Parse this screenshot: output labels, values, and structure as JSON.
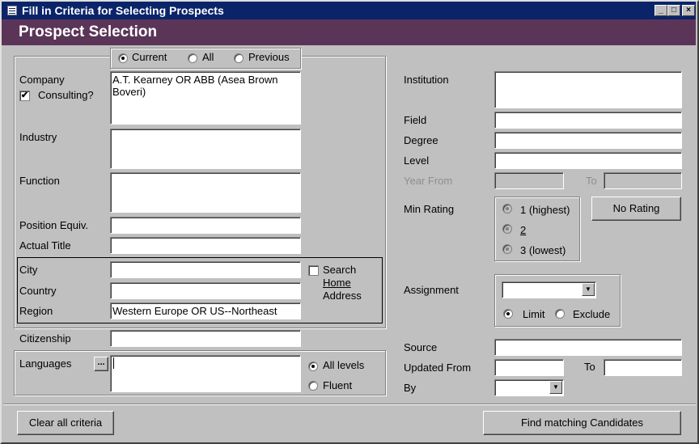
{
  "window": {
    "title": "Fill in Criteria for Selecting Prospects",
    "minimize": "_",
    "restore": "□",
    "close": "×"
  },
  "header": {
    "title": "Prospect Selection"
  },
  "scope": {
    "current": "Current",
    "all": "All",
    "previous": "Previous",
    "selected": "current"
  },
  "left": {
    "company_label": "Company",
    "consulting_label": "Consulting?",
    "consulting_checked": true,
    "consulting_mark": "✔",
    "company_value": "A.T. Kearney OR ABB (Asea Brown Boveri)",
    "industry_label": "Industry",
    "industry_value": "",
    "function_label": "Function",
    "function_value": "",
    "position_label": "Position Equiv.",
    "position_value": "",
    "actual_title_label": "Actual Title",
    "actual_title_value": "",
    "city_label": "City",
    "city_value": "",
    "country_label": "Country",
    "country_value": "",
    "region_label": "Region",
    "region_value": "Western Europe OR US--Northeast",
    "search_home_label1": "Search",
    "search_home_label2": "Home",
    "search_home_label3": "Address",
    "citizenship_label": "Citizenship",
    "citizenship_value": "",
    "languages_label": "Languages",
    "languages_button": "...",
    "languages_value": "",
    "all_levels": "All levels",
    "fluent": "Fluent"
  },
  "right": {
    "institution_label": "Institution",
    "field_label": "Field",
    "degree_label": "Degree",
    "level_label": "Level",
    "year_from_label": "Year From",
    "to_label": "To",
    "min_rating_label": "Min Rating",
    "rating_1": "1 (highest)",
    "rating_2": "2",
    "rating_3": "3 (lowest)",
    "no_rating": "No Rating",
    "assignment_label": "Assignment",
    "limit": "Limit",
    "exclude": "Exclude",
    "source_label": "Source",
    "updated_from_label": "Updated From",
    "updated_to_label": "To",
    "by_label": "By",
    "dropdown_arrow": "▼"
  },
  "footer": {
    "clear": "Clear all criteria",
    "find": "Find matching Candidates"
  }
}
